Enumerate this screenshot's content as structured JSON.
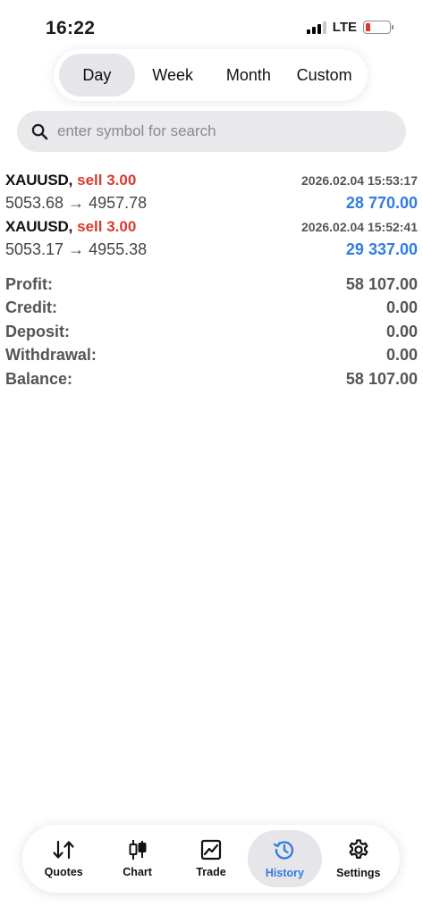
{
  "status_bar": {
    "time": "16:22",
    "network": "LTE",
    "battery_level": 0.15,
    "battery_color": "#e5342b"
  },
  "period_tabs": [
    {
      "label": "Day",
      "active": true
    },
    {
      "label": "Week",
      "active": false
    },
    {
      "label": "Month",
      "active": false
    },
    {
      "label": "Custom",
      "active": false
    }
  ],
  "search": {
    "placeholder": "enter symbol for search",
    "value": "",
    "icon": "magnifier-icon"
  },
  "deals": [
    {
      "symbol": "XAUUSD,",
      "side": "sell 3.00",
      "datetime": "2026.02.04 15:53:17",
      "open_price": "5053.68",
      "arrow": "→",
      "close_price": "4957.78",
      "profit": "28 770.00"
    },
    {
      "symbol": "XAUUSD,",
      "side": "sell 3.00",
      "datetime": "2026.02.04 15:52:41",
      "open_price": "5053.17",
      "arrow": "→",
      "close_price": "4955.38",
      "profit": "29 337.00"
    }
  ],
  "summary": [
    {
      "label": "Profit:",
      "value": "58 107.00"
    },
    {
      "label": "Credit:",
      "value": "0.00"
    },
    {
      "label": "Deposit:",
      "value": "0.00"
    },
    {
      "label": "Withdrawal:",
      "value": "0.00"
    },
    {
      "label": "Balance:",
      "value": "58 107.00"
    }
  ],
  "tab_bar": [
    {
      "label": "Quotes",
      "icon": "quotes-arrows-icon",
      "active": false
    },
    {
      "label": "Chart",
      "icon": "candlestick-icon",
      "active": false
    },
    {
      "label": "Trade",
      "icon": "trade-chart-icon",
      "active": false
    },
    {
      "label": "History",
      "icon": "history-clock-icon",
      "active": true
    },
    {
      "label": "Settings",
      "icon": "gear-icon",
      "active": false
    }
  ],
  "colors": {
    "sell": "#d93a2f",
    "profit": "#2f7de1",
    "active_tab": "#2f7de1"
  }
}
